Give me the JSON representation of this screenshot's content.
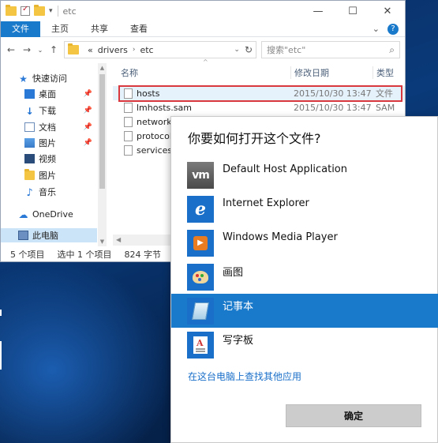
{
  "explorer": {
    "title": "etc",
    "ribbon_tabs": [
      "文件",
      "主页",
      "共享",
      "查看"
    ],
    "breadcrumb": {
      "prefix": "«",
      "segments": [
        "drivers",
        "etc"
      ]
    },
    "search_placeholder": "搜索\"etc\"",
    "columns": {
      "name": "名称",
      "date": "修改日期",
      "type": "类型"
    },
    "nav_items": [
      {
        "label": "快速访问"
      },
      {
        "label": "桌面"
      },
      {
        "label": "下载"
      },
      {
        "label": "文档"
      },
      {
        "label": "图片"
      },
      {
        "label": "视频"
      },
      {
        "label": "图片"
      },
      {
        "label": "音乐"
      },
      {
        "label": "OneDrive"
      },
      {
        "label": "此电脑"
      }
    ],
    "files": [
      {
        "name": "hosts",
        "date": "2015/10/30 13:47",
        "type": "文件"
      },
      {
        "name": "lmhosts.sam",
        "date": "2015/10/30 13:47",
        "type": "SAM"
      },
      {
        "name": "networks",
        "date": "",
        "type": ""
      },
      {
        "name": "protocol",
        "date": "",
        "type": ""
      },
      {
        "name": "services",
        "date": "",
        "type": ""
      }
    ],
    "status": {
      "count": "5 个项目",
      "selected": "选中 1 个项目",
      "size": "824 字节"
    }
  },
  "dialog": {
    "title": "你要如何打开这个文件?",
    "apps": [
      {
        "label": "Default Host Application",
        "icon_text": "vm"
      },
      {
        "label": "Internet Explorer",
        "icon_text": "e"
      },
      {
        "label": "Windows Media Player",
        "icon_text": ""
      },
      {
        "label": "画图",
        "icon_text": ""
      },
      {
        "label": "记事本",
        "icon_text": ""
      },
      {
        "label": "写字板",
        "icon_text": ""
      }
    ],
    "selected_app_index": 4,
    "more_apps_link": "在这台电脑上查找其他应用",
    "ok_label": "确定"
  },
  "colors": {
    "accent": "#1979ca",
    "highlight_border": "#d9383f",
    "dialog_selected": "#1979ca"
  }
}
